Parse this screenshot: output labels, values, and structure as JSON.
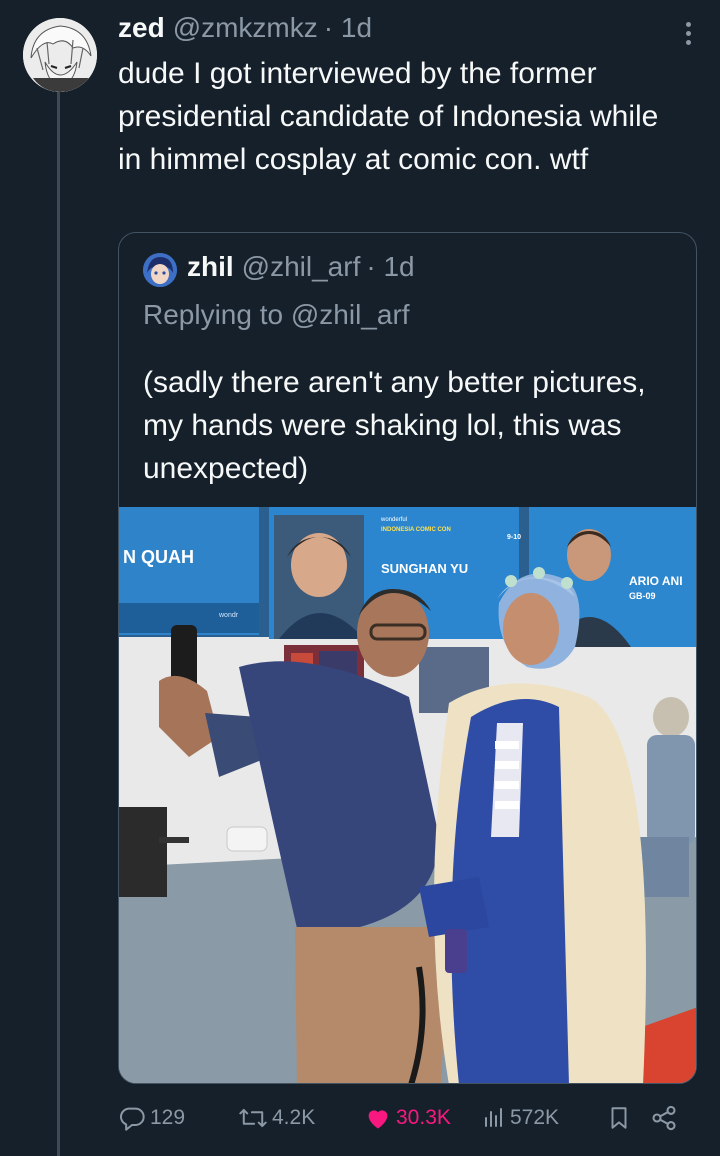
{
  "tweet": {
    "display_name": "zed",
    "handle": "@zmkzmkz",
    "time": "· 1d",
    "text": "dude I got interviewed by the former presidential candidate of Indonesia while in himmel cosplay at comic con. wtf"
  },
  "quote": {
    "display_name": "zhil",
    "handle": "@zhil_arf",
    "time": "· 1d",
    "replying_to": "Replying to @zhil_arf",
    "text": "(sadly there aren't any better pictures, my hands were shaking lol, this was unexpected)",
    "photo_signs": {
      "left_banner": "N QUAH",
      "center_banner": "SUNGHAN YU",
      "right_banner": "ARIO ANI",
      "right_banner_sub": "GB-09",
      "event_small": "INDONESIA COMIC CON",
      "event_tiny": "wonderful",
      "date": "9-10",
      "brand": "wondr"
    }
  },
  "actions": {
    "replies": "129",
    "reposts": "4.2K",
    "likes": "30.3K",
    "views": "572K"
  },
  "colors": {
    "background": "#15202b",
    "text_primary": "#f7f9f9",
    "text_secondary": "#8b98a5",
    "like_active": "#f91880",
    "border": "#425363"
  },
  "icons": [
    "more-icon",
    "reply-icon",
    "repost-icon",
    "like-icon",
    "views-icon",
    "bookmark-icon",
    "share-icon"
  ]
}
